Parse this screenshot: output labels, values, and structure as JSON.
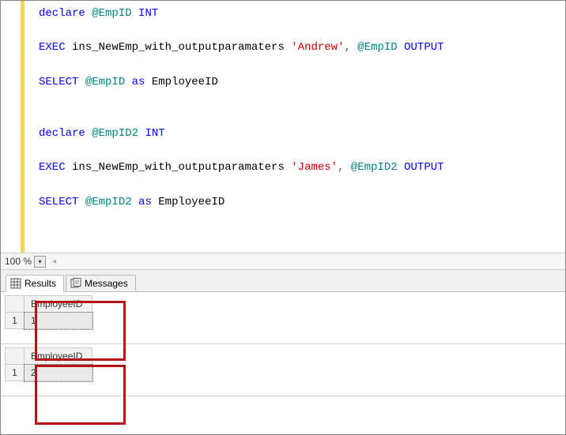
{
  "code": {
    "line1": {
      "declare": "declare",
      "var": "@EmpID",
      "type": "INT"
    },
    "line2": {
      "exec": "EXEC",
      "proc": "ins_NewEmp_with_outputparamaters",
      "str": "'Andrew'",
      "comma": ",",
      "var": "@EmpID",
      "output": "OUTPUT"
    },
    "line3": {
      "select": "SELECT",
      "var": "@EmpID",
      "as": "as",
      "alias": "EmployeeID"
    },
    "line4": {
      "declare": "declare",
      "var": "@EmpID2",
      "type": "INT"
    },
    "line5": {
      "exec": "EXEC",
      "proc": "ins_NewEmp_with_outputparamaters",
      "str": "'James'",
      "comma": ",",
      "var": "@EmpID2",
      "output": "OUTPUT"
    },
    "line6": {
      "select": "SELECT",
      "var": "@EmpID2",
      "as": "as",
      "alias": "EmployeeID"
    }
  },
  "zoom": {
    "value": "100 %"
  },
  "tabs": {
    "results": "Results",
    "messages": "Messages"
  },
  "results": [
    {
      "header": "EmployeeID",
      "rownum": "1",
      "value": "1"
    },
    {
      "header": "EmployeeID",
      "rownum": "1",
      "value": "2"
    }
  ]
}
